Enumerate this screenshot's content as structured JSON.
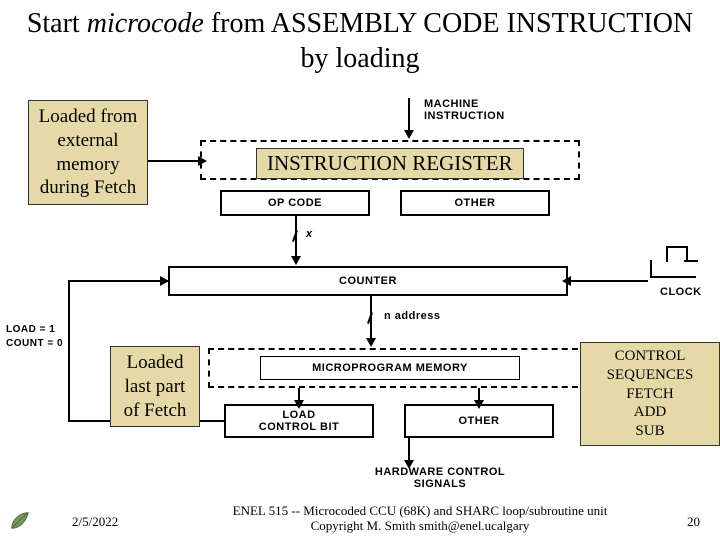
{
  "title": {
    "pre": "Start ",
    "italic": "microcode",
    "mid": " from ASSEMBLY CODE INSTRUCTION",
    "post": " by loading"
  },
  "annotations": {
    "left1": "Loaded from external memory during Fetch",
    "left2": "Loaded last part of Fetch",
    "ir": "INSTRUCTION REGISTER",
    "right": "CONTROL SEQUENCES\nFETCH\nADD\nSUB"
  },
  "diagram": {
    "machine_instruction": "MACHINE\nINSTRUCTION",
    "ir_box": "INSTRUCTION REGISTER",
    "opcode": "OP CODE",
    "other1": "OTHER",
    "counter": "COUNTER",
    "micro_mem": "MICROPROGRAM MEMORY",
    "load_bit": "LOAD\nCONTROL BIT",
    "other2": "OTHER",
    "hw_ctrl": "HARDWARE CONTROL\nSIGNALS",
    "clock": "CLOCK",
    "x_lbl": "x",
    "n_addr": "n   ADDRESS",
    "load1": "LOAD = 1",
    "count0": "COUNT = 0"
  },
  "footer": {
    "date": "2/5/2022",
    "line1": "ENEL 515 -- Microcoded CCU (68K) and SHARC loop/subroutine unit",
    "line2": "Copyright M. Smith smith@enel.ucalgary",
    "page": "20"
  }
}
